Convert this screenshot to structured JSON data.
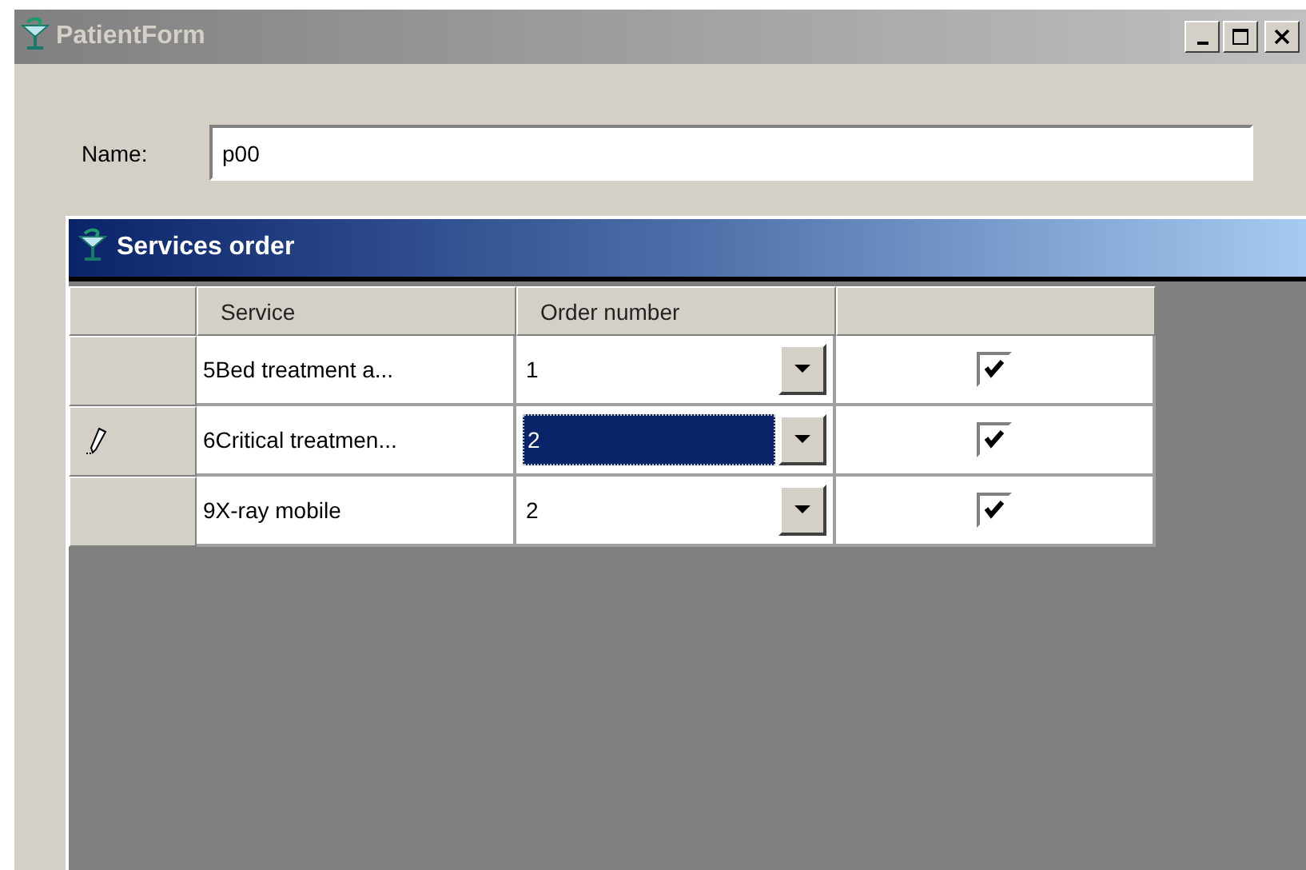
{
  "window": {
    "title": "PatientForm"
  },
  "name_field": {
    "label": "Name:",
    "value": "p00"
  },
  "panel": {
    "title": "Services order",
    "columns": [
      "Service",
      "Order number"
    ],
    "rows": [
      {
        "service": "5Bed treatment a...",
        "order": "1",
        "checked": true,
        "current": false
      },
      {
        "service": "6Critical treatmen...",
        "order": "2",
        "checked": true,
        "current": true
      },
      {
        "service": "9X-ray mobile",
        "order": "2",
        "checked": true,
        "current": false
      }
    ]
  }
}
